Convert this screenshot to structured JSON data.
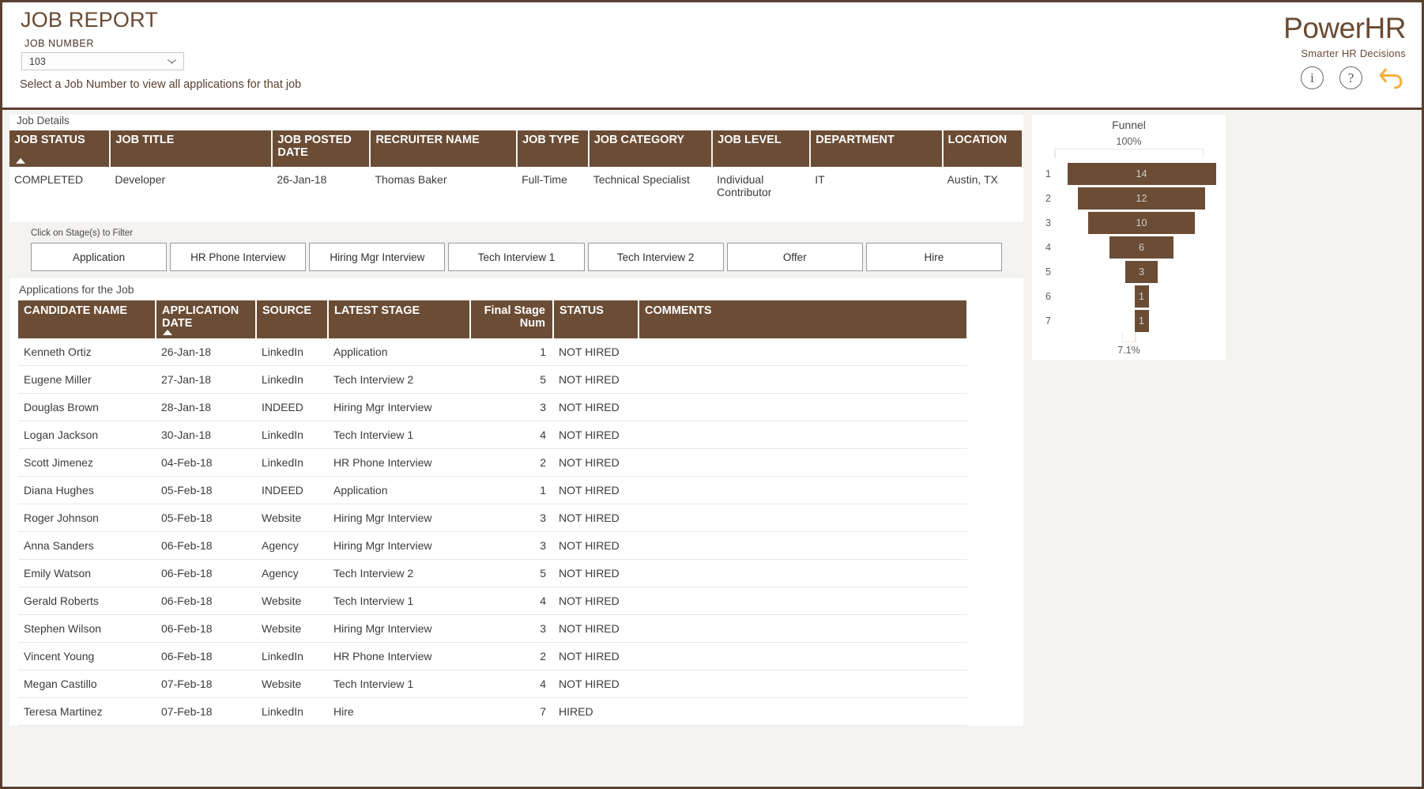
{
  "header": {
    "title": "JOB REPORT",
    "job_number_label": "JOB NUMBER",
    "job_number_value": "103",
    "hint": "Select a Job Number to view all applications for that job",
    "brand_name_part1": "Power",
    "brand_name_part2": "HR",
    "brand_tagline": "Smarter HR Decisions",
    "info_icon_glyph": "i",
    "help_icon_glyph": "?"
  },
  "job_details": {
    "section_label": "Job Details",
    "columns": [
      "JOB STATUS",
      "JOB TITLE",
      "JOB POSTED DATE",
      "RECRUITER NAME",
      "JOB TYPE",
      "JOB CATEGORY",
      "JOB LEVEL",
      "DEPARTMENT",
      "LOCATION"
    ],
    "sorted_column_index": 0,
    "row": [
      "COMPLETED",
      "Developer",
      "26-Jan-18",
      "Thomas Baker",
      "Full-Time",
      "Technical Specialist",
      "Individual Contributor",
      "IT",
      "Austin, TX"
    ]
  },
  "stage_filter": {
    "hint": "Click on Stage(s) to Filter",
    "stages": [
      "Application",
      "HR Phone Interview",
      "Hiring Mgr Interview",
      "Tech Interview 1",
      "Tech Interview 2",
      "Offer",
      "Hire"
    ]
  },
  "applications": {
    "section_label": "Applications for the Job",
    "columns": [
      "CANDIDATE NAME",
      "APPLICATION DATE",
      "SOURCE",
      "LATEST STAGE",
      "Final Stage Num",
      "STATUS",
      "COMMENTS"
    ],
    "sorted_column_index": 1,
    "rows": [
      [
        "Kenneth Ortiz",
        "26-Jan-18",
        "LinkedIn",
        "Application",
        "1",
        "NOT HIRED",
        ""
      ],
      [
        "Eugene Miller",
        "27-Jan-18",
        "LinkedIn",
        "Tech Interview 2",
        "5",
        "NOT HIRED",
        ""
      ],
      [
        "Douglas Brown",
        "28-Jan-18",
        "INDEED",
        "Hiring Mgr Interview",
        "3",
        "NOT HIRED",
        ""
      ],
      [
        "Logan Jackson",
        "30-Jan-18",
        "LinkedIn",
        "Tech Interview 1",
        "4",
        "NOT HIRED",
        ""
      ],
      [
        "Scott Jimenez",
        "04-Feb-18",
        "LinkedIn",
        "HR Phone Interview",
        "2",
        "NOT HIRED",
        ""
      ],
      [
        "Diana Hughes",
        "05-Feb-18",
        "INDEED",
        "Application",
        "1",
        "NOT HIRED",
        ""
      ],
      [
        "Roger Johnson",
        "05-Feb-18",
        "Website",
        "Hiring Mgr Interview",
        "3",
        "NOT HIRED",
        ""
      ],
      [
        "Anna Sanders",
        "06-Feb-18",
        "Agency",
        "Hiring Mgr Interview",
        "3",
        "NOT HIRED",
        ""
      ],
      [
        "Emily Watson",
        "06-Feb-18",
        "Agency",
        "Tech Interview 2",
        "5",
        "NOT HIRED",
        ""
      ],
      [
        "Gerald Roberts",
        "06-Feb-18",
        "Website",
        "Tech Interview 1",
        "4",
        "NOT HIRED",
        ""
      ],
      [
        "Stephen Wilson",
        "06-Feb-18",
        "Website",
        "Hiring Mgr Interview",
        "3",
        "NOT HIRED",
        ""
      ],
      [
        "Vincent Young",
        "06-Feb-18",
        "LinkedIn",
        "HR Phone Interview",
        "2",
        "NOT HIRED",
        ""
      ],
      [
        "Megan Castillo",
        "07-Feb-18",
        "Website",
        "Tech Interview 1",
        "4",
        "NOT HIRED",
        ""
      ],
      [
        "Teresa Martinez",
        "07-Feb-18",
        "LinkedIn",
        "Hire",
        "7",
        "HIRED",
        ""
      ]
    ]
  },
  "chart_data": {
    "type": "bar",
    "title": "Funnel",
    "xlabel": "",
    "ylabel": "",
    "top_percent_label": "100%",
    "bottom_percent_label": "7.1%",
    "categories": [
      "1",
      "2",
      "3",
      "4",
      "5",
      "6",
      "7"
    ],
    "values": [
      14,
      12,
      10,
      6,
      3,
      1,
      1
    ],
    "ylim": [
      0,
      14
    ],
    "grid": false,
    "legend": "none",
    "bar_color": "#6b4c35",
    "label_color": "#cfcfcf"
  },
  "colors": {
    "brand_brown": "#6a4a33",
    "header_brown": "#6b4c35",
    "undo_amber": "#f5b041",
    "panel_bg": "#f4f3f1"
  }
}
